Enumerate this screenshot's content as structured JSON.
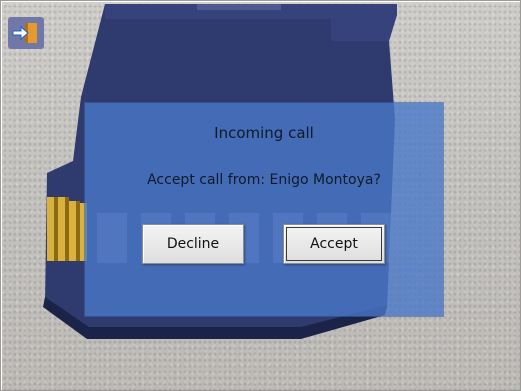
{
  "app": {
    "icon": "exit-arrow-icon"
  },
  "dialog": {
    "title": "Incoming call",
    "message": "Accept call from: Enigo Montoya?",
    "decline_label": "Decline",
    "accept_label": "Accept"
  },
  "colors": {
    "dialog_background": "#4a78c8",
    "button_background": "#e8e8e8",
    "card_body": "#2f3a6e",
    "icon_arrow": "#1f5fd0",
    "icon_tile": "#e49a2e"
  }
}
